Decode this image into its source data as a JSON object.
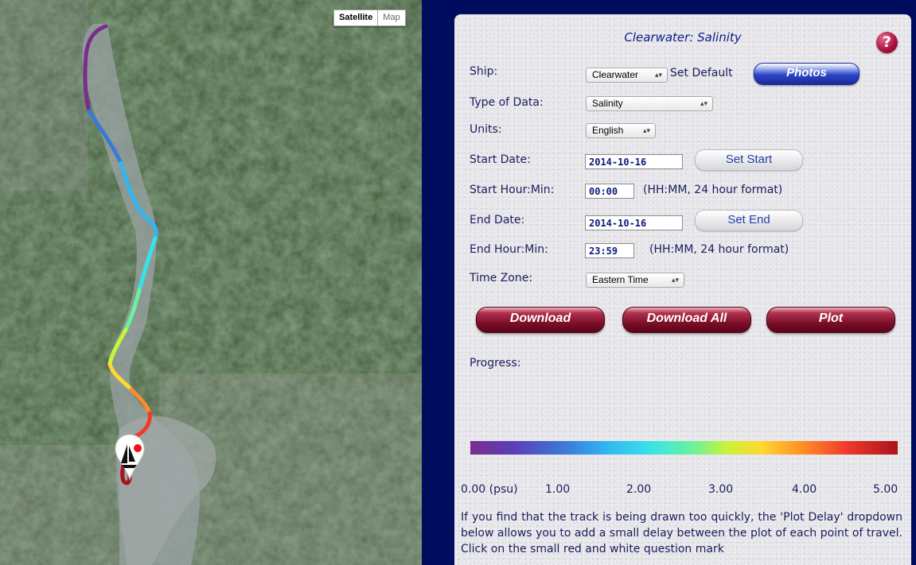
{
  "map": {
    "toggle": {
      "satellite": "Satellite",
      "map": "Map",
      "active": "Satellite"
    },
    "track_colors": [
      "#7b2d8e",
      "#5b3fb6",
      "#3b79d9",
      "#31b6f2",
      "#38e2e8",
      "#6af29b",
      "#c8f43a",
      "#ffd830",
      "#ff8c28",
      "#ef3a2b",
      "#a8141a"
    ]
  },
  "panel": {
    "title": "Clearwater: Salinity",
    "help_label": "?",
    "ship": {
      "label": "Ship:",
      "value": "Clearwater",
      "set_default": "Set Default"
    },
    "photos_label": "Photos",
    "data_type": {
      "label": "Type of Data:",
      "value": "Salinity"
    },
    "units": {
      "label": "Units:",
      "value": "English"
    },
    "start_date": {
      "label": "Start Date:",
      "value": "2014-10-16",
      "button": "Set Start"
    },
    "start_time": {
      "label": "Start Hour:Min:",
      "value": "00:00",
      "hint": "(HH:MM, 24 hour format)"
    },
    "end_date": {
      "label": "End Date:",
      "value": "2014-10-16",
      "button": "Set End"
    },
    "end_time": {
      "label": "End Hour:Min:",
      "value": "23:59",
      "hint": "(HH:MM, 24 hour format)"
    },
    "time_zone": {
      "label": "Time Zone:",
      "value": "Eastern Time"
    },
    "buttons": {
      "download": "Download",
      "download_all": "Download All",
      "plot": "Plot"
    },
    "progress_label": "Progress:",
    "scale_ticks": [
      "0.00 (psu)",
      "1.00",
      "2.00",
      "3.00",
      "4.00",
      "5.00"
    ],
    "note": "If you find that the track is being drawn too quickly, the 'Plot Delay' dropdown below allows you to add a small delay between the plot of each point of travel. Click on the small red and white question mark"
  },
  "colors": {
    "panel_bg": "#e6e6ea",
    "page_bg": "#000d5e",
    "label_text": "#1a1d5c",
    "maroon_button": "#7a0e28",
    "blue_button": "#2b45c8"
  }
}
